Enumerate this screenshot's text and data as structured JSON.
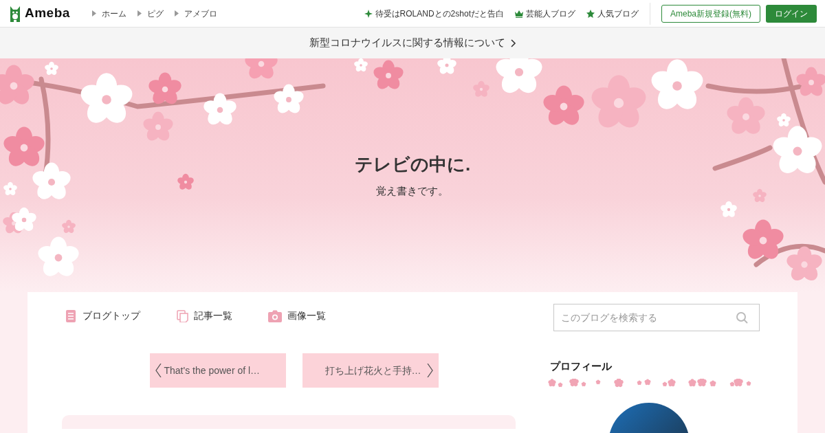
{
  "header": {
    "logo_text": "Ameba",
    "nav_links": [
      "ホーム",
      "ピグ",
      "アメブロ"
    ],
    "right_links": [
      {
        "kind": "sparkle",
        "label": "待受はROLANDとの2shotだと告白"
      },
      {
        "kind": "crown",
        "label": "芸能人ブログ"
      },
      {
        "kind": "star",
        "label": "人気ブログ"
      }
    ],
    "register_button": "Ameba新規登録(無料)",
    "login_button": "ログイン"
  },
  "notice": {
    "text": "新型コロナウイルスに関する情報について"
  },
  "blog": {
    "title": "テレビの中に.",
    "subtitle": "覚え書きです。"
  },
  "blog_nav": [
    {
      "kind": "document",
      "label": "ブログトップ"
    },
    {
      "kind": "pages",
      "label": "記事一覧"
    },
    {
      "kind": "camera",
      "label": "画像一覧"
    }
  ],
  "search": {
    "placeholder": "このブログを検索する"
  },
  "pager": {
    "previous": "That's the power of l…",
    "next": "打ち上げ花火と手持…"
  },
  "sidebar": {
    "heading": "プロフィール"
  }
}
